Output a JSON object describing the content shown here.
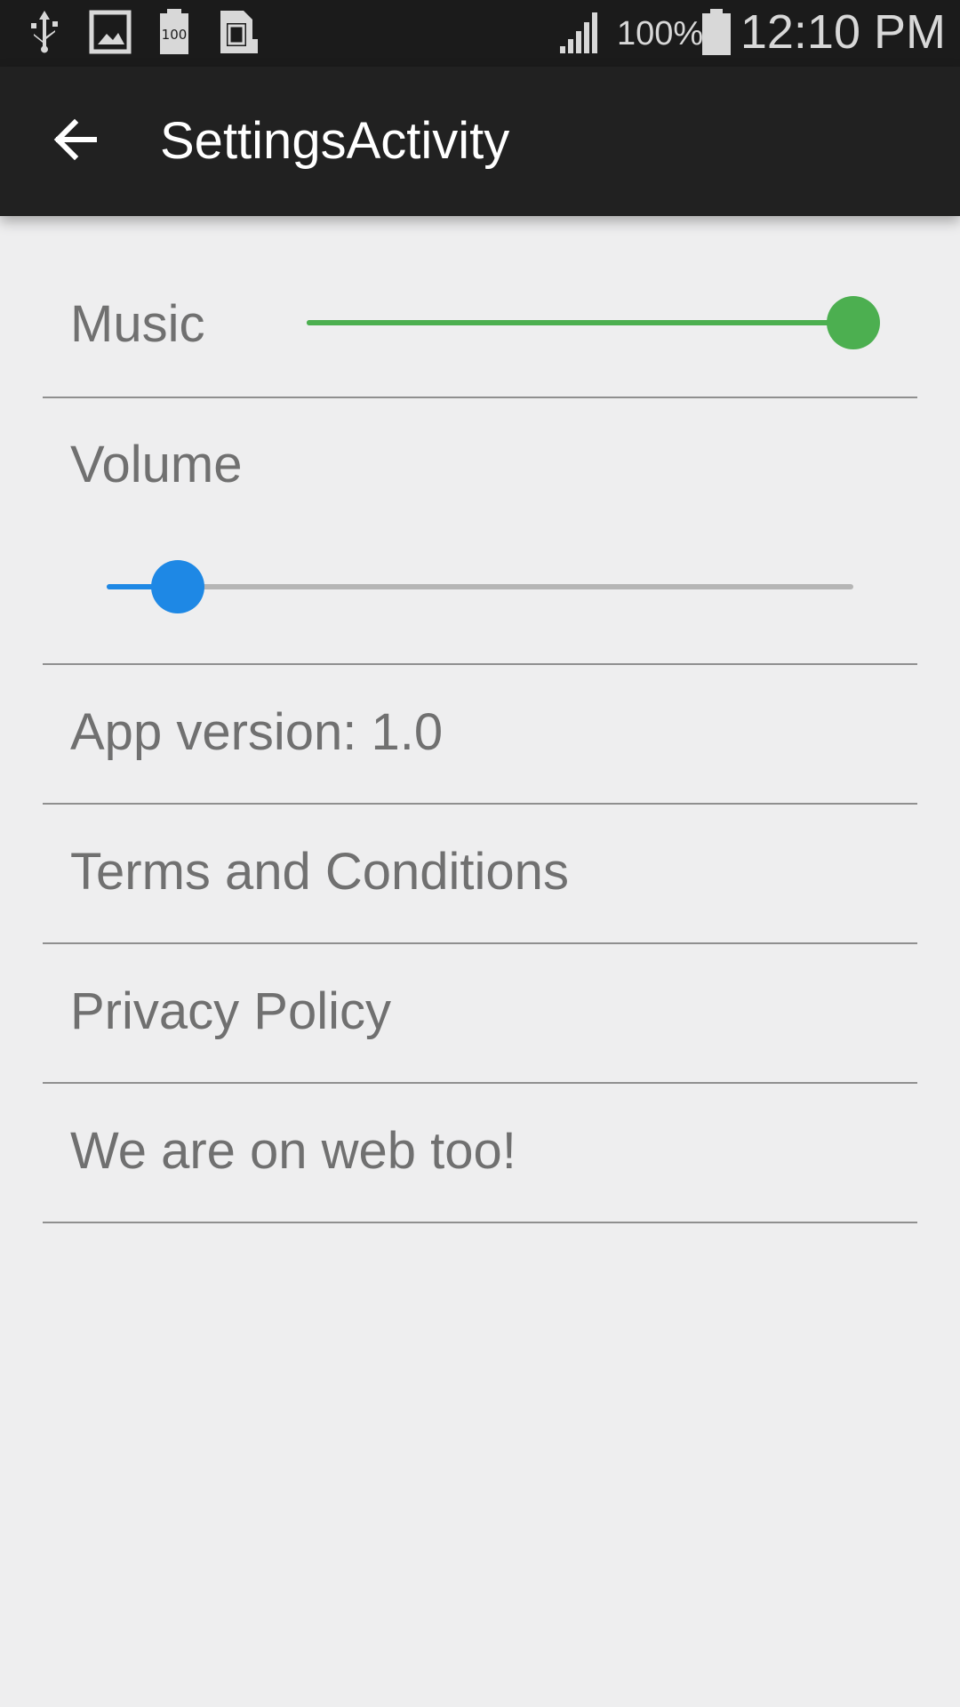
{
  "status_bar": {
    "icons_left": [
      "usb-icon",
      "image-icon",
      "battery-100-icon",
      "sim-card-icon"
    ],
    "icons_right": [
      "signal-icon",
      "battery-icon"
    ],
    "battery_percent": "100%",
    "time": "12:10 PM"
  },
  "app_bar": {
    "back_icon": "arrow-back-icon",
    "title": "SettingsActivity"
  },
  "settings": {
    "music": {
      "label": "Music",
      "value": 1.0,
      "color": "#4caf50",
      "track_color": "#4caf50"
    },
    "volume": {
      "label": "Volume",
      "value": 0.095,
      "color": "#1e88e5",
      "track_color": "#b5b5b5"
    },
    "app_version": "App version: 1.0",
    "terms": "Terms and Conditions",
    "privacy": "Privacy Policy",
    "web": "We are on web too!"
  },
  "colors": {
    "status_bar_bg": "#1b1b1b",
    "app_bar_bg": "#212121",
    "background": "#eeeeef",
    "text": "#707070",
    "divider": "#8f8f8f"
  }
}
